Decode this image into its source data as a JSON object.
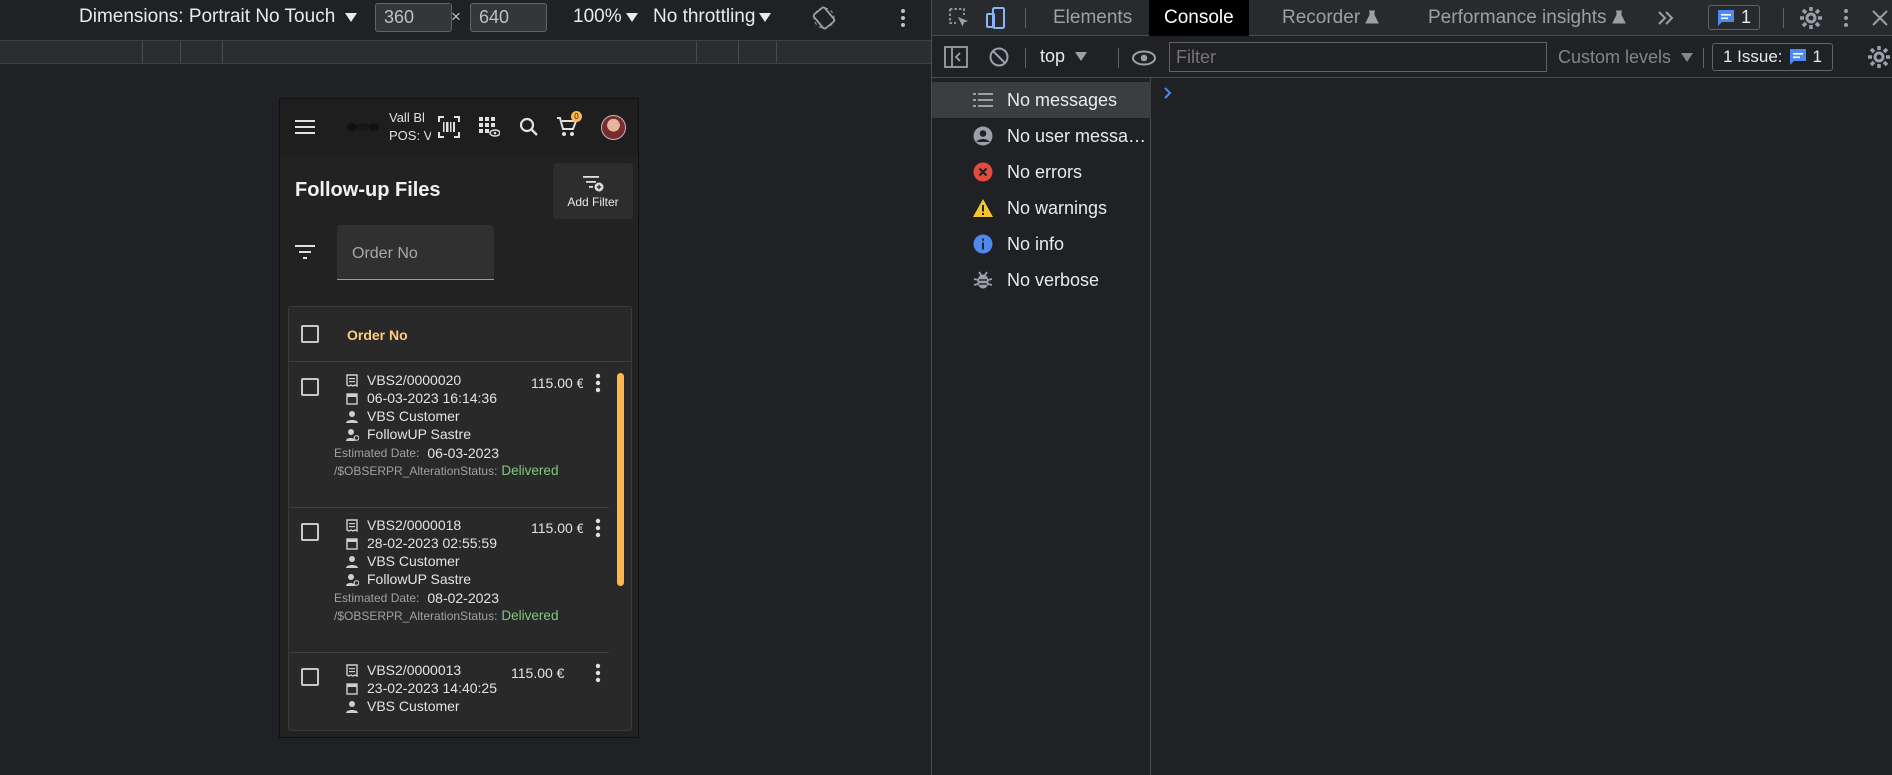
{
  "device_toolbar": {
    "dimensions_label": "Dimensions: Portrait No Touch",
    "width_value": "360",
    "height_value": "640",
    "times": "×",
    "zoom": "100%",
    "throttling": "No throttling"
  },
  "app": {
    "brand_line1": "Vall Bl",
    "brand_line2": "POS: V",
    "cart_count": "0",
    "page_title": "Follow-up Files",
    "add_filter_label": "Add Filter",
    "order_input_placeholder": "Order No",
    "table_header": "Order No",
    "rows": [
      {
        "order": "VBS2/0000020",
        "date": "06-03-2023 16:14:36",
        "customer": "VBS Customer",
        "tailor": "FollowUP Sastre",
        "estimated_label": "Estimated Date:",
        "estimated_date": "06-03-2023",
        "status_label": "/$OBSERPR_AlterationStatus:",
        "status": "Delivered",
        "price": "115.00 €"
      },
      {
        "order": "VBS2/0000018",
        "date": "28-02-2023 02:55:59",
        "customer": "VBS Customer",
        "tailor": "FollowUP Sastre",
        "estimated_label": "Estimated Date:",
        "estimated_date": "08-02-2023",
        "status_label": "/$OBSERPR_AlterationStatus:",
        "status": "Delivered",
        "price": "115.00 €"
      },
      {
        "order": "VBS2/0000013",
        "date": "23-02-2023 14:40:25",
        "customer": "VBS Customer",
        "tailor": "",
        "estimated_label": "",
        "estimated_date": "",
        "status_label": "",
        "status": "",
        "price": "115.00 €"
      }
    ]
  },
  "devtools": {
    "tabs": [
      "Elements",
      "Console",
      "Recorder",
      "Performance insights"
    ],
    "active_tab": "Console",
    "issues_chip_count": "1",
    "context": "top",
    "filter_placeholder": "Filter",
    "levels": "Custom levels",
    "issues_label": "1 Issue:",
    "issues_count": "1",
    "sidebar": [
      {
        "label": "No messages",
        "icon": "list-icon"
      },
      {
        "label": "No user messa…",
        "icon": "user-icon"
      },
      {
        "label": "No errors",
        "icon": "error-icon"
      },
      {
        "label": "No warnings",
        "icon": "warning-icon"
      },
      {
        "label": "No info",
        "icon": "info-icon"
      },
      {
        "label": "No verbose",
        "icon": "bug-icon"
      }
    ],
    "colors": {
      "error": "#e34b3f",
      "warning": "#f4c531",
      "info": "#4d8af0",
      "accent": "#ffb74d",
      "delivered": "#81c784"
    }
  }
}
